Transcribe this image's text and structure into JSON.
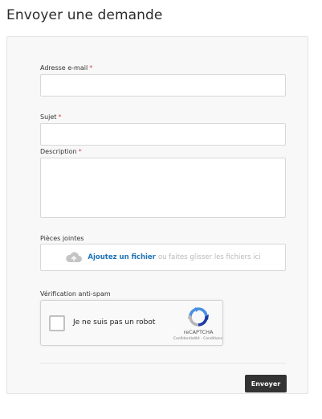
{
  "page": {
    "title": "Envoyer une demande"
  },
  "form": {
    "email": {
      "label": "Adresse e-mail",
      "required_mark": "*",
      "value": ""
    },
    "subject": {
      "label": "Sujet",
      "required_mark": "*",
      "value": ""
    },
    "description": {
      "label": "Description",
      "required_mark": "*",
      "value": ""
    },
    "attachments": {
      "label": "Pièces jointes",
      "add_link": "Ajoutez un fichier",
      "drag_text": "ou faites glisser les fichiers ici",
      "icon": "cloud-upload-icon"
    },
    "spam": {
      "label": "Vérification anti-spam",
      "checkbox_label": "Je ne suis pas un robot",
      "brand": "reCAPTCHA",
      "legal": "Confidentialité - Conditions",
      "checked": false
    },
    "submit_label": "Envoyer"
  },
  "colors": {
    "required": "#e0464e",
    "link": "#1f73b7",
    "button_bg": "#333333",
    "panel_bg": "#f8f8f8"
  }
}
